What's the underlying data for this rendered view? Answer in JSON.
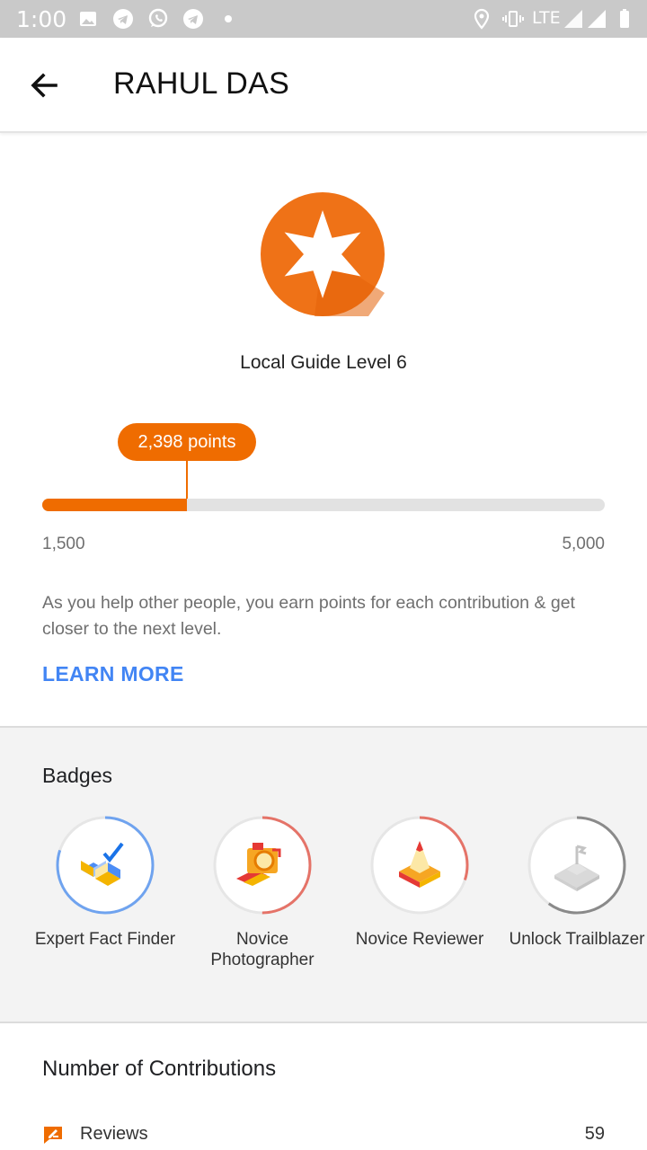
{
  "status_bar": {
    "time": "1:00",
    "network": "LTE"
  },
  "header": {
    "title": "RAHUL DAS"
  },
  "level": {
    "title": "Local Guide Level 6",
    "points_label": "2,398 points",
    "range_min": "1,500",
    "range_max": "5,000",
    "progress": 0.2566,
    "description": "As you help other people, you earn points for each contribution & get closer to the next level.",
    "learn_more": "LEARN MORE",
    "accent_color": "#ef6c00"
  },
  "badges": {
    "title": "Badges",
    "items": [
      {
        "label": "Expert Fact Finder",
        "icon": "fact-finder-icon",
        "ring_color": "#6fa3ef",
        "ring_progress": 0.8
      },
      {
        "label": "Novice Photographer",
        "icon": "photographer-icon",
        "ring_color": "#e57368",
        "ring_progress": 0.5
      },
      {
        "label": "Novice Reviewer",
        "icon": "reviewer-icon",
        "ring_color": "#e57368",
        "ring_progress": 0.3
      },
      {
        "label": "Unlock Trailblazer",
        "icon": "trailblazer-icon",
        "ring_color": "#8a8a8a",
        "ring_progress": 0.6
      }
    ]
  },
  "contributions": {
    "title": "Number of Contributions",
    "rows": [
      {
        "label": "Reviews",
        "value": "59",
        "icon": "review-icon"
      }
    ]
  }
}
